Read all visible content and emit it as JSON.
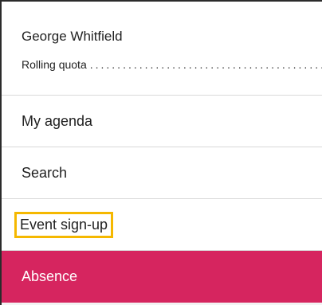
{
  "profile": {
    "name": "George Whitfield",
    "quota_label": "Rolling quota",
    "quota_dots": "..............................................."
  },
  "menu": {
    "items": [
      {
        "label": "My agenda",
        "state": "normal"
      },
      {
        "label": "Search",
        "state": "normal"
      },
      {
        "label": "Event sign-up",
        "state": "highlighted"
      },
      {
        "label": "Absence",
        "state": "active"
      }
    ]
  },
  "colors": {
    "active_background": "#d6255f",
    "highlight_outline": "#f5b800",
    "divider": "#d9d9d9"
  }
}
